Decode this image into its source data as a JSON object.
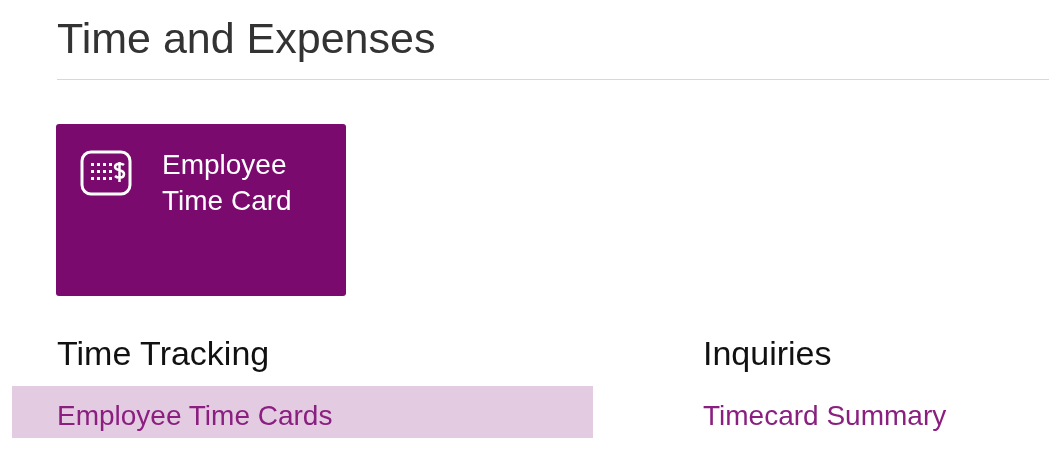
{
  "title": "Time and Expenses",
  "tiles": [
    {
      "label": "Employee\nTime Card"
    }
  ],
  "sections": [
    {
      "heading": "Time Tracking",
      "links": [
        {
          "label": "Employee Time Cards",
          "selected": true
        }
      ]
    },
    {
      "heading": "Inquiries",
      "links": [
        {
          "label": "Timecard Summary",
          "selected": false
        }
      ]
    }
  ]
}
